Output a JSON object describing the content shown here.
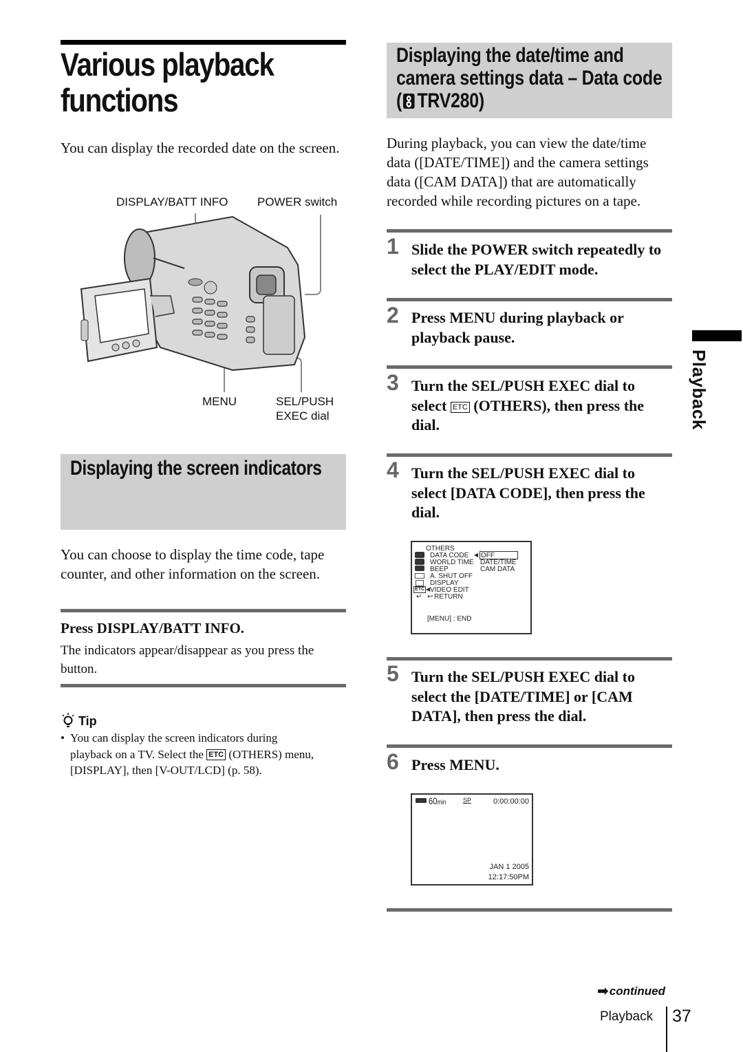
{
  "page": {
    "title": "Various playback functions",
    "title_lines": [
      "Various playback",
      "functions"
    ],
    "intro": "You can display the recorded date on the screen.",
    "page_number": "37",
    "footer_section": "Playback",
    "side_tab_label": "Playback",
    "continued_label": "continued"
  },
  "figure": {
    "labels": {
      "display_batt_info": "DISPLAY/BATT INFO",
      "power_switch": "POWER switch",
      "menu": "MENU",
      "sel_push_line1": "SEL/PUSH",
      "sel_push_line2": "EXEC dial"
    }
  },
  "left_section": {
    "heading": "Displaying the screen indicators",
    "body": "You can choose to display the time code, tape counter, and other information on the screen.",
    "step_title": "Press DISPLAY/BATT INFO.",
    "step_body": "The indicators appear/disappear as you press the button.",
    "tip_label": "Tip",
    "tip_lines": [
      "You can display the screen indicators during",
      "playback on a TV. Select the",
      "(OTHERS) menu,",
      "[DISPLAY], then [V-OUT/LCD] (p. 58)."
    ],
    "etc_icon": "ETC"
  },
  "right_section": {
    "heading_lines": [
      "Displaying the date/time and",
      "camera settings data – Data code",
      "TRV280)"
    ],
    "heading_open": "(",
    "body": "During playback, you can view the date/time data ([DATE/TIME]) and the camera settings data ([CAM DATA]) that are automatically recorded while recording pictures on a tape.",
    "steps": [
      {
        "num": "1",
        "lines": [
          "Slide the POWER switch repeatedly to",
          "select the PLAY/EDIT mode."
        ]
      },
      {
        "num": "2",
        "lines": [
          "Press MENU during playback or",
          "playback pause."
        ]
      },
      {
        "num": "3",
        "lines": [
          "Turn the SEL/PUSH EXEC dial to",
          "select",
          "(OTHERS), then press the",
          "dial."
        ]
      },
      {
        "num": "4",
        "lines": [
          "Turn the SEL/PUSH EXEC dial to",
          "select [DATA CODE], then press the",
          "dial."
        ]
      },
      {
        "num": "5",
        "lines": [
          "Turn the SEL/PUSH EXEC dial to",
          "select the [DATE/TIME] or [CAM",
          "DATA], then press the dial."
        ]
      },
      {
        "num": "6",
        "lines": [
          "Press MENU."
        ]
      }
    ],
    "etc_icon": "ETC"
  },
  "menu_screen": {
    "header": "OTHERS",
    "items": [
      "DATA CODE",
      "WORLD TIME",
      "BEEP",
      "A. SHUT  OFF",
      "DISPLAY",
      "VIDEO  EDIT",
      "RETURN"
    ],
    "options": [
      "OFF",
      "DATE/TIME",
      "CAM  DATA"
    ],
    "selected_option": "OFF",
    "footer": "[MENU] : END",
    "etc_icon": "ETC"
  },
  "playback_screen": {
    "battery": "60",
    "battery_unit": "min",
    "mode": "SP",
    "timecode": "0:00:00:00",
    "date": "JAN  1  2005",
    "time": "12:17:50PM"
  }
}
